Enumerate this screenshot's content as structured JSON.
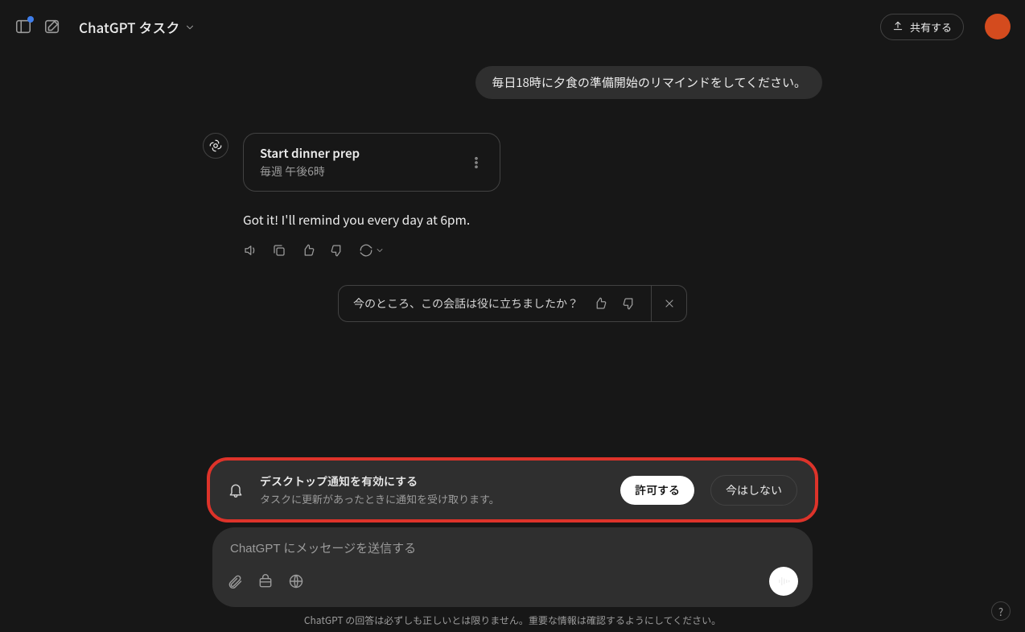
{
  "header": {
    "title": "ChatGPT タスク",
    "share_label": "共有する"
  },
  "conversation": {
    "user_message": "毎日18時に夕食の準備開始のリマインドをしてください。",
    "task_card": {
      "title": "Start dinner prep",
      "subtitle": "毎週 午後6時"
    },
    "assistant_message": "Got it! I'll remind you every day at 6pm."
  },
  "feedback": {
    "prompt": "今のところ、この会話は役に立ちましたか？"
  },
  "notification_banner": {
    "title": "デスクトップ通知を有効にする",
    "subtitle": "タスクに更新があったときに通知を受け取ります。",
    "allow_label": "許可する",
    "deny_label": "今はしない"
  },
  "composer": {
    "placeholder": "ChatGPT にメッセージを送信する"
  },
  "footer": {
    "disclaimer": "ChatGPT の回答は必ずしも正しいとは限りません。重要な情報は確認するようにしてください。"
  },
  "help": {
    "label": "?"
  }
}
